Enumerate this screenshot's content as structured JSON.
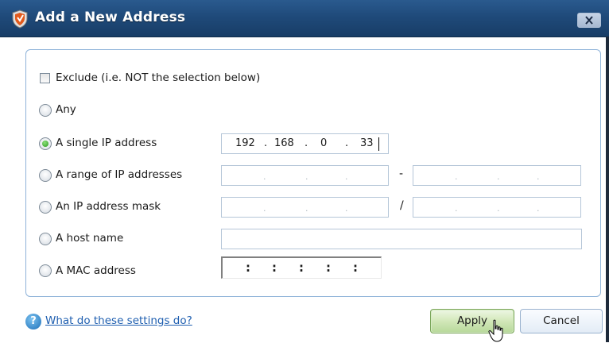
{
  "window": {
    "title": "Add a New Address"
  },
  "options": {
    "exclude_label": "Exclude (i.e. NOT the selection below)",
    "any_label": "Any",
    "single_ip_label": "A single IP address",
    "range_label": "A range of IP addresses",
    "mask_label": "An IP address mask",
    "host_label": "A host name",
    "mac_label": "A MAC address",
    "selected": "single_ip"
  },
  "single_ip": {
    "octets": [
      "192",
      "168",
      "0",
      "33"
    ],
    "separator": "."
  },
  "range": {
    "separator": "-"
  },
  "mask": {
    "separator": "/"
  },
  "host": {
    "value": ""
  },
  "mac": {
    "separator": ":"
  },
  "footer": {
    "help_link": "What do these settings do?",
    "apply_label": "Apply",
    "cancel_label": "Cancel"
  },
  "colors": {
    "titlebar": "#1f4a7a",
    "panel_border": "#8fb3d9",
    "link": "#1f5fb0",
    "apply_button": "#cfe6b5"
  }
}
